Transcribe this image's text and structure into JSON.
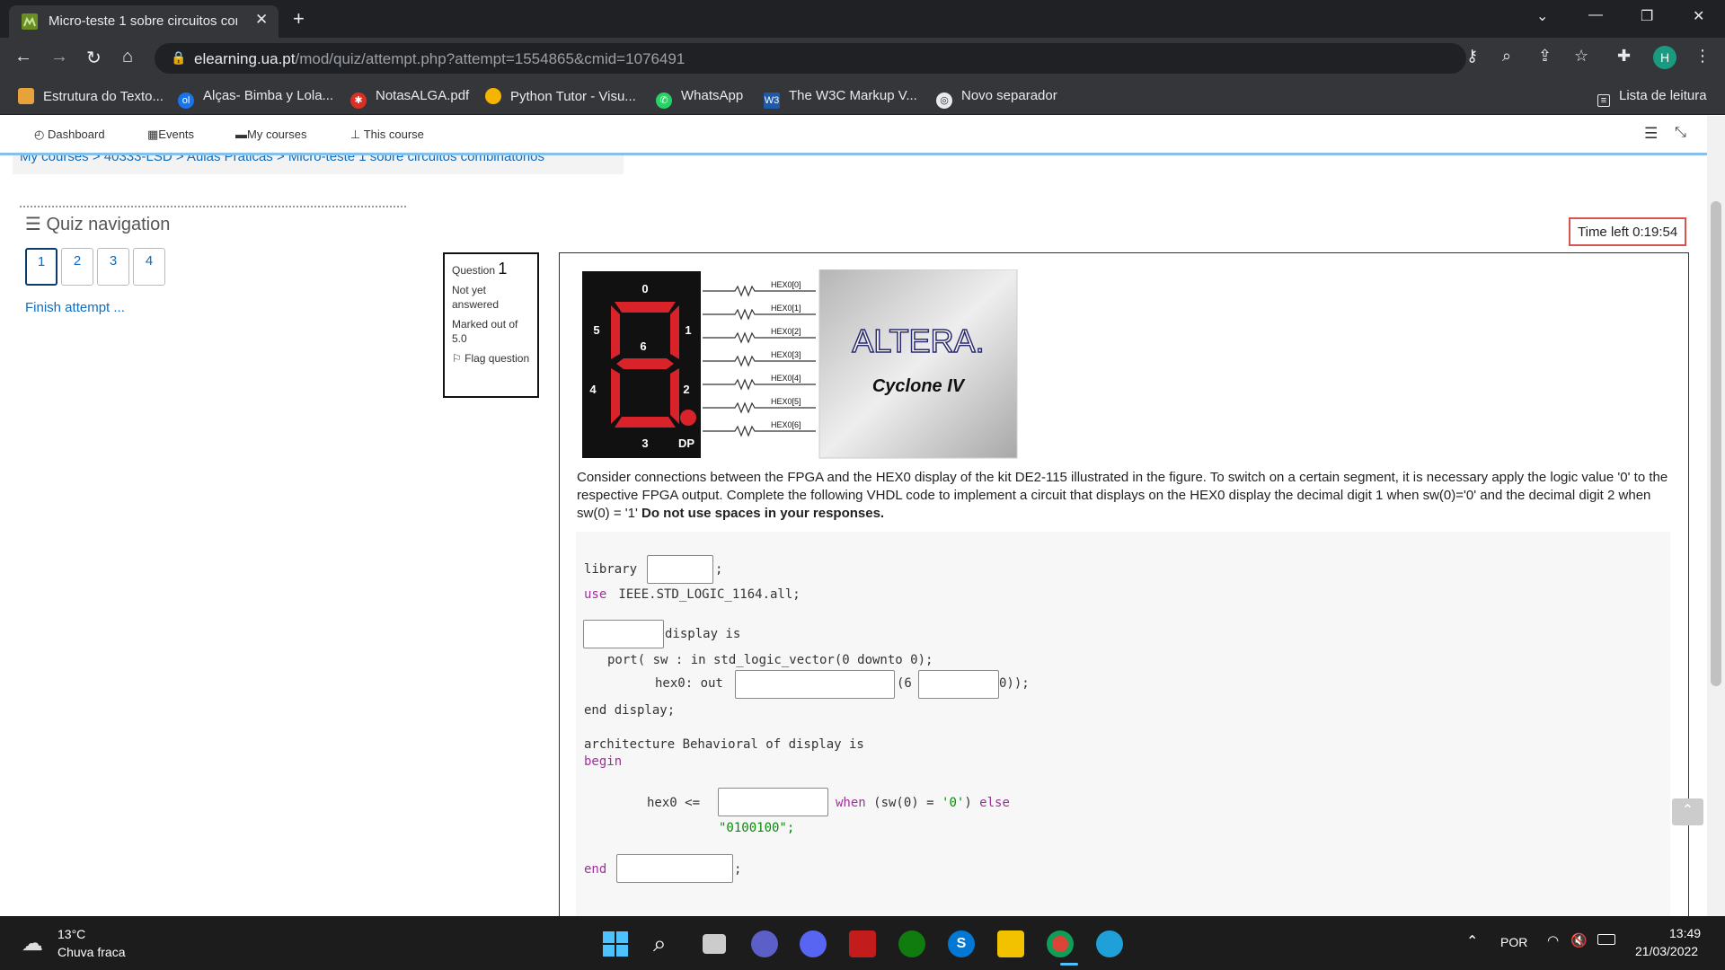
{
  "browser": {
    "tab_title": "Micro-teste 1 sobre circuitos com",
    "url_domain": "elearning.ua.pt",
    "url_path": "/mod/quiz/attempt.php?attempt=1554865&cmid=1076491",
    "profile_initial": "H",
    "bookmarks": [
      {
        "label": "Estrutura do Texto...",
        "color": "#e8a23a"
      },
      {
        "label": "Alças- Bimba y Lola...",
        "color": "#1a73e8"
      },
      {
        "label": "NotasALGA.pdf",
        "color": "#d93025"
      },
      {
        "label": "Python Tutor - Visu...",
        "color": "#f4b400"
      },
      {
        "label": "WhatsApp",
        "color": "#25d366"
      },
      {
        "label": "The W3C Markup V...",
        "color": "#1f5aa8"
      },
      {
        "label": "Novo separador",
        "color": "#e8eaed"
      }
    ],
    "reading_list": "Lista de leitura"
  },
  "moodle_nav": {
    "items": [
      "Dashboard",
      "Events",
      "My courses",
      "This course"
    ],
    "breadcrumb": "My courses  >  40333-LSD  >  Aulas Práticas  >  Micro-teste 1 sobre circuitos combinatórios"
  },
  "quiz_nav": {
    "title": "Quiz navigation",
    "questions": [
      "1",
      "2",
      "3",
      "4"
    ],
    "finish": "Finish attempt ..."
  },
  "question_info": {
    "label": "Question",
    "number": "1",
    "state": "Not yet answered",
    "marks": "Marked out of 5.0",
    "flag": "Flag question"
  },
  "timer": "Time left 0:19:54",
  "figure": {
    "segments": [
      "0",
      "1",
      "2",
      "3",
      "4",
      "5",
      "6",
      "DP"
    ],
    "hex_labels": [
      "HEX0[0]",
      "HEX0[1]",
      "HEX0[2]",
      "HEX0[3]",
      "HEX0[4]",
      "HEX0[5]",
      "HEX0[6]"
    ],
    "brand": "ALTERA.",
    "chip": "Cyclone IV"
  },
  "question": {
    "text": "Consider connections between the FPGA and the HEX0 display of the kit DE2-115 illustrated in the figure. To switch on a certain segment, it is necessary apply the logic value '0' to the respective FPGA output. Complete the following VHDL code to implement a circuit that displays on the HEX0 display the decimal digit 1 when sw(0)='0' and the decimal digit 2 when sw(0) = '1'",
    "emphasis": "Do not use spaces in your responses."
  },
  "code": {
    "library": "library",
    "semicolon": ";",
    "use_kw": "use",
    "use_rest": " IEEE.STD_LOGIC_1164.all;",
    "display_is": "display is",
    "port_line": "port( sw : in std_logic_vector(0 downto 0);",
    "hex0_out": "hex0: out",
    "six": "(6",
    "close": "0));",
    "end_display": "end display;",
    "architecture": "architecture Behavioral of display is",
    "begin": "begin",
    "assign": "hex0 <=",
    "when_kw": "when",
    "cond": " (sw(0) = ",
    "zero_str": "'0'",
    "paren": ")",
    "else_kw": " else",
    "literal": "\"0100100\";",
    "end": "end"
  },
  "taskbar": {
    "temp": "13°C",
    "weather": "Chuva fraca",
    "lang": "POR",
    "time": "13:49",
    "date": "21/03/2022"
  }
}
